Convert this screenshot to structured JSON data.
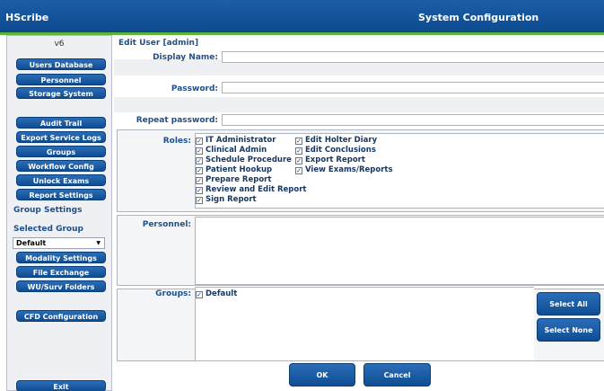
{
  "app_name": "HScribe",
  "window_title": "System Configuration",
  "sidebar": {
    "version": "v6",
    "buttons_top": [
      "Users Database",
      "Personnel",
      "Storage System"
    ],
    "buttons_mid": [
      "Audit Trail",
      "Export Service Logs",
      "Groups",
      "Workflow Config",
      "Unlock Exams",
      "Report Settings"
    ],
    "group_settings_label": "Group Settings",
    "selected_group_label": "Selected Group",
    "selected_group_value": "Default",
    "group_buttons": [
      "Modality Settings",
      "File Exchange",
      "WU/Surv Folders"
    ],
    "cfd_button": "CFD Configuration",
    "exit_button": "Exit"
  },
  "form": {
    "section_title": "Edit User [admin]",
    "display_name_label": "Display Name:",
    "display_name_value": "",
    "password_label": "Password:",
    "repeat_password_label": "Repeat password:",
    "roles_label": "Roles:",
    "roles_col1": [
      "IT Administrator",
      "Clinical Admin",
      "Schedule Procedure",
      "Patient Hookup",
      "Prepare Report",
      "Review and Edit Report",
      "Sign Report"
    ],
    "roles_col2": [
      "Edit Holter Diary",
      "Edit Conclusions",
      "Export Report",
      "View Exams/Reports"
    ],
    "personnel_label": "Personnel:",
    "groups_label": "Groups:",
    "groups": [
      "Default"
    ],
    "select_all": "Select All",
    "select_none": "Select None",
    "ok": "OK",
    "cancel": "Cancel"
  }
}
